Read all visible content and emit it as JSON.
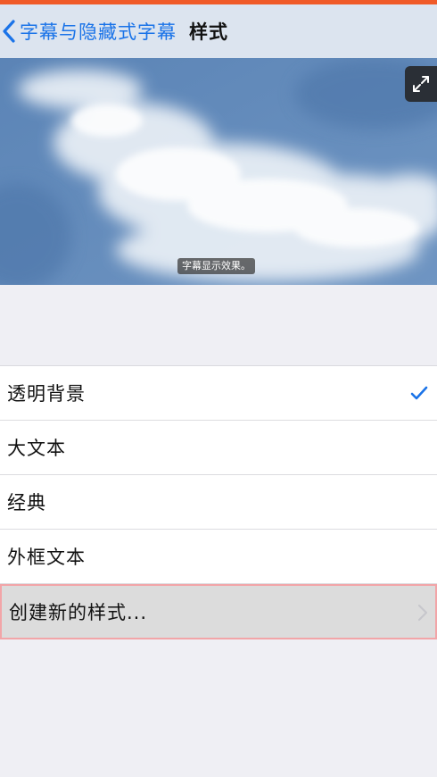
{
  "colors": {
    "accent": "#1a73e8",
    "nav_background": "#dce4ef",
    "page_background": "#efeff4",
    "highlight_border": "#f2a5a8",
    "top_strip": "#f05a28"
  },
  "nav": {
    "back_label": "字幕与隐藏式字幕",
    "back_icon": "chevron-left-icon",
    "title": "样式"
  },
  "preview": {
    "caption": "字幕显示效果。",
    "expand_icon": "expand-icon"
  },
  "styles": {
    "items": [
      {
        "label": "透明背景",
        "selected": true
      },
      {
        "label": "大文本",
        "selected": false
      },
      {
        "label": "经典",
        "selected": false
      },
      {
        "label": "外框文本",
        "selected": false
      }
    ],
    "create_label": "创建新的样式...",
    "check_icon": "checkmark-icon",
    "create_icon": "chevron-right-icon"
  }
}
